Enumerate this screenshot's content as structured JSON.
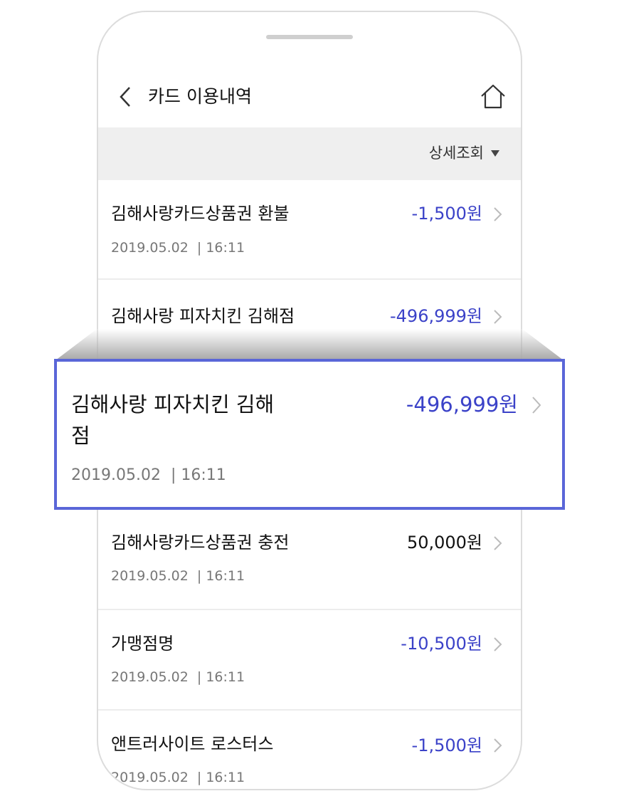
{
  "header": {
    "title": "카드 이용내역"
  },
  "filter": {
    "label": "상세조회"
  },
  "colors": {
    "negative_amount": "#3b42c8",
    "positive_amount": "#111111",
    "highlight_border": "#5a66d8"
  },
  "transactions": [
    {
      "name": "김해사랑카드상품권 환불",
      "amount": "-1,500원",
      "date": "2019.05.02",
      "time": "16:11"
    },
    {
      "name": "김해사랑 피자치킨 김해점",
      "amount": "-496,999원",
      "date": "2019.05.02",
      "time": "16:11"
    },
    {
      "name": "김해사랑카드상품권 충전",
      "amount": "50,000원",
      "date": "2019.05.02",
      "time": "16:11"
    },
    {
      "name": "가맹점명",
      "amount": "-10,500원",
      "date": "2019.05.02",
      "time": "16:11"
    },
    {
      "name": "앤트러사이트 로스터스",
      "amount": "-1,500원",
      "date": "2019.05.02",
      "time": "16:11"
    }
  ],
  "highlight": {
    "name": "김해사랑 피자치킨 김해점",
    "amount": "-496,999원",
    "date": "2019.05.02",
    "time": "16:11"
  }
}
